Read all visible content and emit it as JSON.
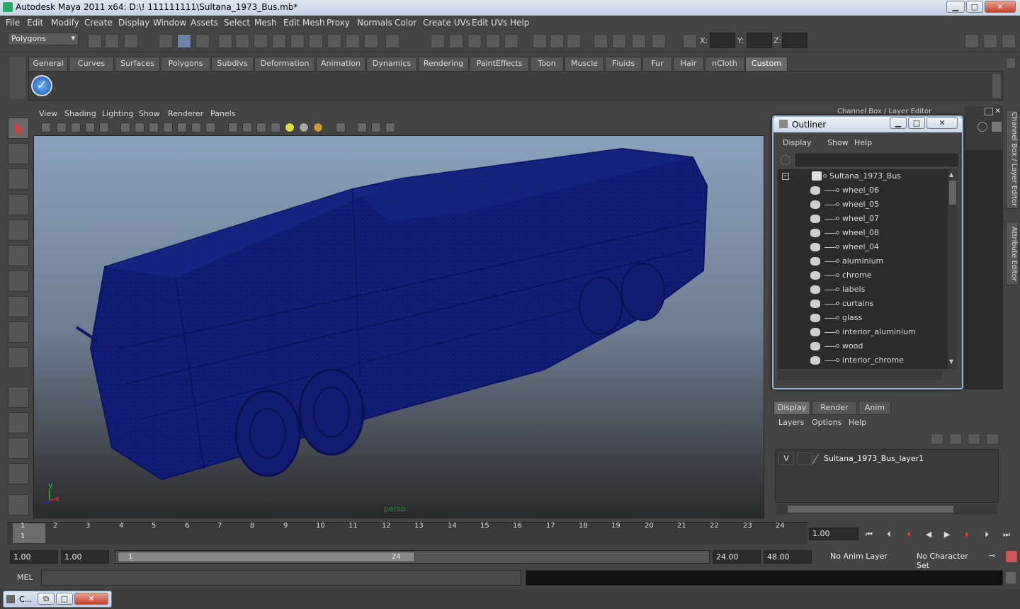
{
  "window": {
    "title": "Autodesk Maya 2011 x64: D:\\! 111111111\\Sultana_1973_Bus.mb*",
    "min": "▁",
    "max": "□",
    "close": "✕"
  },
  "menu": [
    "File",
    "Edit",
    "Modify",
    "Create",
    "Display",
    "Window",
    "Assets",
    "Select",
    "Mesh",
    "Edit Mesh",
    "Proxy",
    "Normals",
    "Color",
    "Create UVs",
    "Edit UVs",
    "Help"
  ],
  "status": {
    "mode": "Polygons",
    "x_label": "X:",
    "y_label": "Y:",
    "z_label": "Z:"
  },
  "shelf_tabs": [
    "General",
    "Curves",
    "Surfaces",
    "Polygons",
    "Subdivs",
    "Deformation",
    "Animation",
    "Dynamics",
    "Rendering",
    "PaintEffects",
    "Toon",
    "Muscle",
    "Fluids",
    "Fur",
    "Hair",
    "nCloth",
    "Custom"
  ],
  "shelf_active": "Custom",
  "viewport": {
    "menu": [
      "View",
      "Shading",
      "Lighting",
      "Show",
      "Renderer",
      "Panels"
    ],
    "camera": "persp",
    "mesh_color": "#0d1a6b",
    "axis": {
      "y": "y",
      "x": "x"
    }
  },
  "outliner": {
    "title": "Outliner",
    "menu": [
      "Display",
      "Show",
      "Help"
    ],
    "root": "Sultana_1973_Bus",
    "items": [
      "wheel_06",
      "wheel_05",
      "wheel_07",
      "wheel_08",
      "wheel_04",
      "aluminium",
      "chrome",
      "labels",
      "curtains",
      "glass",
      "interior_aluminium",
      "wood",
      "interior_chrome"
    ]
  },
  "channel_box_title": "Channel Box / Layer Editor",
  "side_tabs": [
    "Channel Box / Layer Editor",
    "Attribute Editor"
  ],
  "layer_editor": {
    "tabs": [
      "Display",
      "Render",
      "Anim"
    ],
    "active_tab": "Display",
    "menu": [
      "Layers",
      "Options",
      "Help"
    ],
    "layer": {
      "visible": "V",
      "name": "Sultana_1973_Bus_layer1"
    }
  },
  "timeline": {
    "ticks": [
      "1",
      "2",
      "3",
      "4",
      "5",
      "6",
      "7",
      "8",
      "9",
      "10",
      "11",
      "12",
      "13",
      "14",
      "15",
      "16",
      "17",
      "18",
      "19",
      "20",
      "21",
      "22",
      "23",
      "24"
    ],
    "current_frame_marker": "1",
    "current_time": "1.00"
  },
  "range": {
    "start": "1.00",
    "start2": "1.00",
    "thumb_start": "1",
    "thumb_end": "24",
    "end": "24.00",
    "end2": "48.00",
    "anim_layer": "No Anim Layer",
    "char_set": "No Character Set"
  },
  "cmd": {
    "label": "MEL"
  },
  "minimized": {
    "title": "C..."
  }
}
